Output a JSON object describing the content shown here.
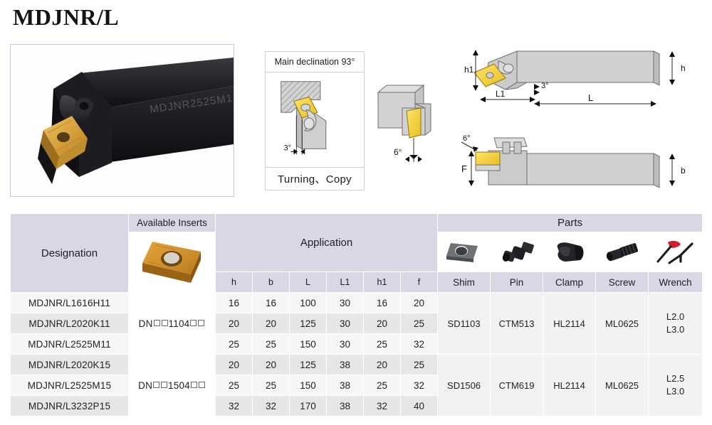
{
  "title": "MDJNR/L",
  "photo": {
    "engraving": "MDJNR2525M1",
    "alt": "lathe turning tool holder"
  },
  "diagrams": {
    "declination": {
      "title": "Main declination 93°",
      "caption": "Turning、Copy",
      "angle_label": "3°"
    },
    "end_view": {
      "angle_label": "6°"
    },
    "side_view": {
      "h1": "h1",
      "L1": "L1",
      "L": "L",
      "h": "h",
      "angle_label": "3°"
    },
    "top_view": {
      "F": "F",
      "b": "b",
      "angle_label": "6°"
    }
  },
  "table": {
    "headers": {
      "designation": "Designation",
      "available_inserts": "Available Inserts",
      "application": "Application",
      "parts": "Parts",
      "dims": [
        "h",
        "b",
        "L",
        "L1",
        "h1",
        "f"
      ],
      "parts_cols": [
        "Shim",
        "Pin",
        "Clamp",
        "Screw",
        "Wrench"
      ]
    },
    "rows": [
      {
        "designation": "MDJNR/L1616H11",
        "h": "16",
        "b": "16",
        "L": "100",
        "L1": "30",
        "h1": "16",
        "f": "20"
      },
      {
        "designation": "MDJNR/L2020K11",
        "h": "20",
        "b": "20",
        "L": "125",
        "L1": "30",
        "h1": "20",
        "f": "25"
      },
      {
        "designation": "MDJNR/L2525M11",
        "h": "25",
        "b": "25",
        "L": "150",
        "L1": "30",
        "h1": "25",
        "f": "32"
      },
      {
        "designation": "MDJNR/L2020K15",
        "h": "20",
        "b": "20",
        "L": "125",
        "L1": "38",
        "h1": "20",
        "f": "25"
      },
      {
        "designation": "MDJNR/L2525M15",
        "h": "25",
        "b": "25",
        "L": "150",
        "L1": "38",
        "h1": "25",
        "f": "32"
      },
      {
        "designation": "MDJNR/L3232P15",
        "h": "32",
        "b": "32",
        "L": "170",
        "L1": "38",
        "h1": "32",
        "f": "40"
      }
    ],
    "insert_groups": [
      {
        "prefix": "DN",
        "code": "1104",
        "rowspan": 3
      },
      {
        "prefix": "DN",
        "code": "1504",
        "rowspan": 3
      }
    ],
    "parts_groups": [
      {
        "shim": "SD1103",
        "pin": "CTM513",
        "clamp": "HL2114",
        "screw": "ML0625",
        "wrench_1": "L2.0",
        "wrench_2": "L3.0"
      },
      {
        "shim": "SD1506",
        "pin": "CTM619",
        "clamp": "HL2114",
        "screw": "ML0625",
        "wrench_1": "L2.5",
        "wrench_2": "L3.0"
      }
    ]
  },
  "colors": {
    "header_bg": "#d8d7e6",
    "row_light": "#f6f6f6",
    "row_dark": "#e6e6e6",
    "parts_bg": "#f2f2f2",
    "insert_gold": "#d9a441",
    "tool_dark": "#1b1b1d",
    "wrench_red": "#cc1f2a"
  }
}
